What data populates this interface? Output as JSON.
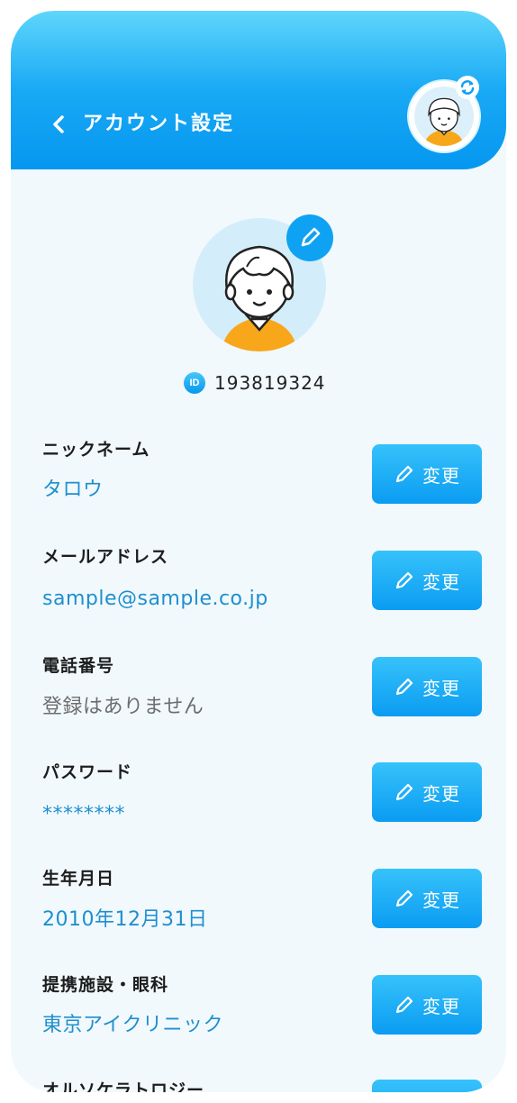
{
  "header": {
    "title": "アカウント設定"
  },
  "profile": {
    "id_badge": "ID",
    "id_value": "193819324"
  },
  "fields": [
    {
      "label": "ニックネーム",
      "value": "タロウ",
      "button": "変更"
    },
    {
      "label": "メールアドレス",
      "value": "sample@sample.co.jp",
      "button": "変更"
    },
    {
      "label": "電話番号",
      "value": "登録はありません",
      "button": "変更"
    },
    {
      "label": "パスワード",
      "value": "********",
      "button": "変更"
    },
    {
      "label": "生年月日",
      "value": "2010年12月31日",
      "button": "変更"
    },
    {
      "label": "提携施設・眼科",
      "value": "東京アイクリニック",
      "button": "変更"
    },
    {
      "label": "オルソケラトロジー",
      "value": "",
      "button": ""
    }
  ],
  "colors": {
    "accent": "#0fa2f3",
    "value_text": "#1f8fcf",
    "background": "#f1f9fd"
  }
}
